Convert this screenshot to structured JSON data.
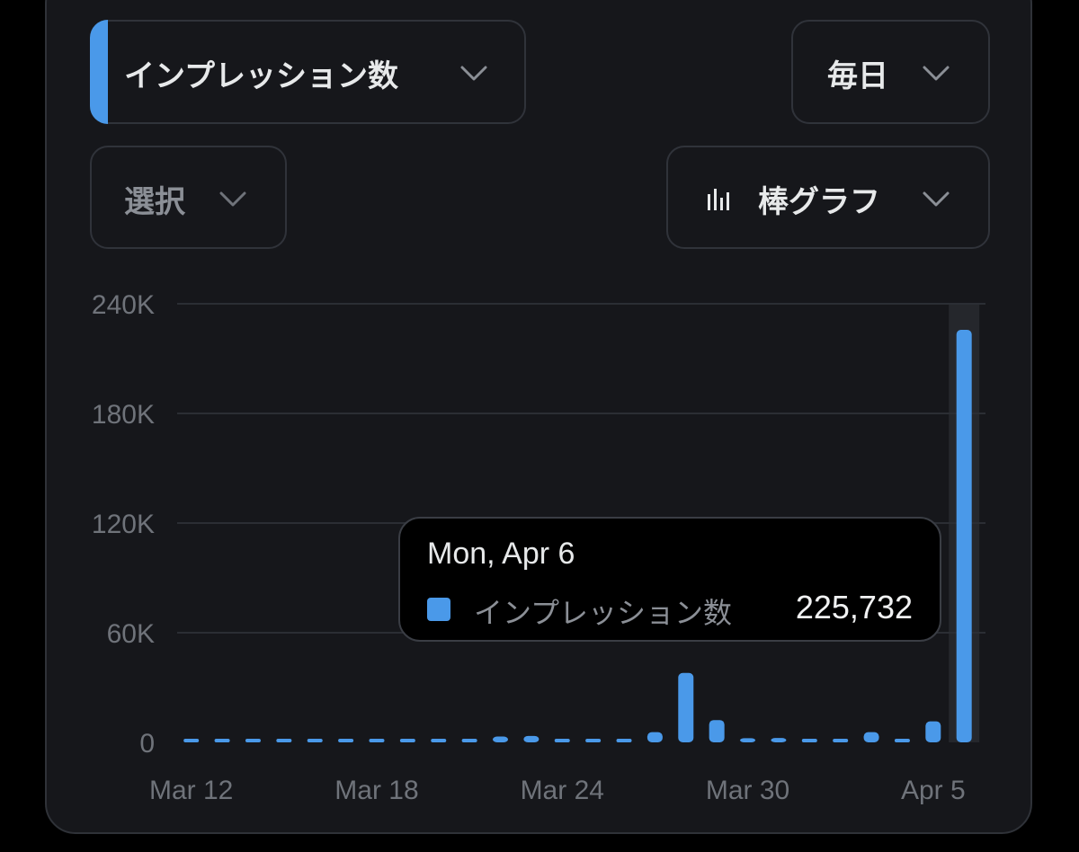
{
  "controls": {
    "metric_label": "インプレッション数",
    "interval_label": "毎日",
    "select_label": "選択",
    "chart_type_label": "棒グラフ"
  },
  "colors": {
    "accent": "#4a99e9",
    "background": "#16171b",
    "border": "#30333a",
    "text": "#e7e9ea",
    "muted": "#8b8f96"
  },
  "icons": {
    "chevron": "chevron-down-icon",
    "chart_type": "bar-chart-icon"
  },
  "tooltip": {
    "date": "Mon, Apr 6",
    "series": "インプレッション数",
    "value": "225,732"
  },
  "chart_data": {
    "type": "bar",
    "ylim": [
      0,
      240000
    ],
    "yticks": [
      0,
      60000,
      120000,
      180000,
      240000
    ],
    "ytick_labels": [
      "0",
      "60K",
      "120K",
      "180K",
      "240K"
    ],
    "xtick_labels": [
      "Mar 12",
      "Mar 18",
      "Mar 24",
      "Mar 30",
      "Apr 5"
    ],
    "categories": [
      "Mar 12",
      "Mar 13",
      "Mar 14",
      "Mar 15",
      "Mar 16",
      "Mar 17",
      "Mar 18",
      "Mar 19",
      "Mar 20",
      "Mar 21",
      "Mar 22",
      "Mar 23",
      "Mar 24",
      "Mar 25",
      "Mar 26",
      "Mar 27",
      "Mar 28",
      "Mar 29",
      "Mar 30",
      "Mar 31",
      "Apr 1",
      "Apr 2",
      "Apr 3",
      "Apr 4",
      "Apr 5",
      "Apr 6"
    ],
    "series": [
      {
        "name": "インプレッション数",
        "values": [
          300,
          300,
          300,
          300,
          300,
          300,
          300,
          300,
          300,
          300,
          3200,
          3500,
          1100,
          1200,
          700,
          5600,
          38000,
          12200,
          2300,
          2400,
          1400,
          1400,
          5600,
          1800,
          11500,
          225732
        ]
      }
    ],
    "highlighted": "Apr 6",
    "grid": true
  }
}
